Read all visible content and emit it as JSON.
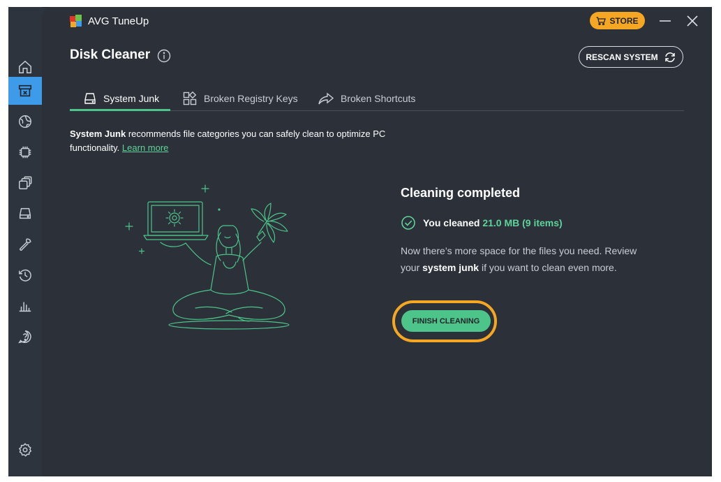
{
  "app": {
    "title": "AVG TuneUp"
  },
  "window": {
    "store_label": "STORE"
  },
  "page": {
    "title": "Disk Cleaner",
    "rescan_label": "RESCAN SYSTEM"
  },
  "tabs": [
    {
      "label": "System Junk"
    },
    {
      "label": "Broken Registry Keys"
    },
    {
      "label": "Broken Shortcuts"
    }
  ],
  "description": {
    "bold": "System Junk",
    "text": " recommends file categories you can safely clean to optimize PC functionality. ",
    "link": "Learn more"
  },
  "result": {
    "title": "Cleaning completed",
    "cleaned_prefix": "You cleaned ",
    "cleaned_value": "21.0 MB (9 items)",
    "body_1": "Now there’s more space for the files you need. Review your ",
    "body_bold": "system junk",
    "body_2": " if you want to clean even more.",
    "finish_label": "FINISH CLEANING"
  },
  "sidebar": {
    "items": [
      {
        "icon": "home-icon"
      },
      {
        "icon": "disk-cleaner-icon"
      },
      {
        "icon": "globe-icon"
      },
      {
        "icon": "chip-icon"
      },
      {
        "icon": "windows-stack-icon"
      },
      {
        "icon": "drive-icon"
      },
      {
        "icon": "wrench-icon"
      },
      {
        "icon": "history-icon"
      },
      {
        "icon": "stats-icon"
      },
      {
        "icon": "help-icon"
      },
      {
        "icon": "settings-icon"
      }
    ]
  },
  "colors": {
    "accent": "#4dc58a",
    "active_nav": "#3d9be9",
    "store": "#f5a623",
    "highlight_ring": "#f5a623"
  }
}
